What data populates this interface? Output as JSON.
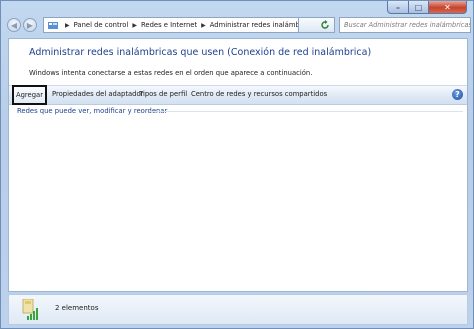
{
  "window": {
    "caption_buttons": {
      "minimize": "–",
      "maximize": "□",
      "close": "✕"
    }
  },
  "nav": {
    "back_icon": "arrow-left-icon",
    "forward_icon": "arrow-right-icon",
    "breadcrumbs": [
      "Panel de control",
      "Redes e Internet",
      "Administrar redes inalámbricas"
    ],
    "refresh_icon": "refresh-icon",
    "search_placeholder": "Buscar Administrar redes inalámbricas"
  },
  "content": {
    "title": "Administrar redes inalámbricas que usen (Conexión de red inalámbrica)",
    "subtitle": "Windows intenta conectarse a estas redes en el orden que aparece a continuación.",
    "toolbar": {
      "agregar": "Agregar",
      "propiedades": "Propiedades del adaptador",
      "tipos": "Tipos de perfil",
      "centro": "Centro de redes y recursos compartidos"
    },
    "list_header": "Redes que puede ver, modificar y reordenar"
  },
  "status": {
    "count": "2 elementos"
  }
}
